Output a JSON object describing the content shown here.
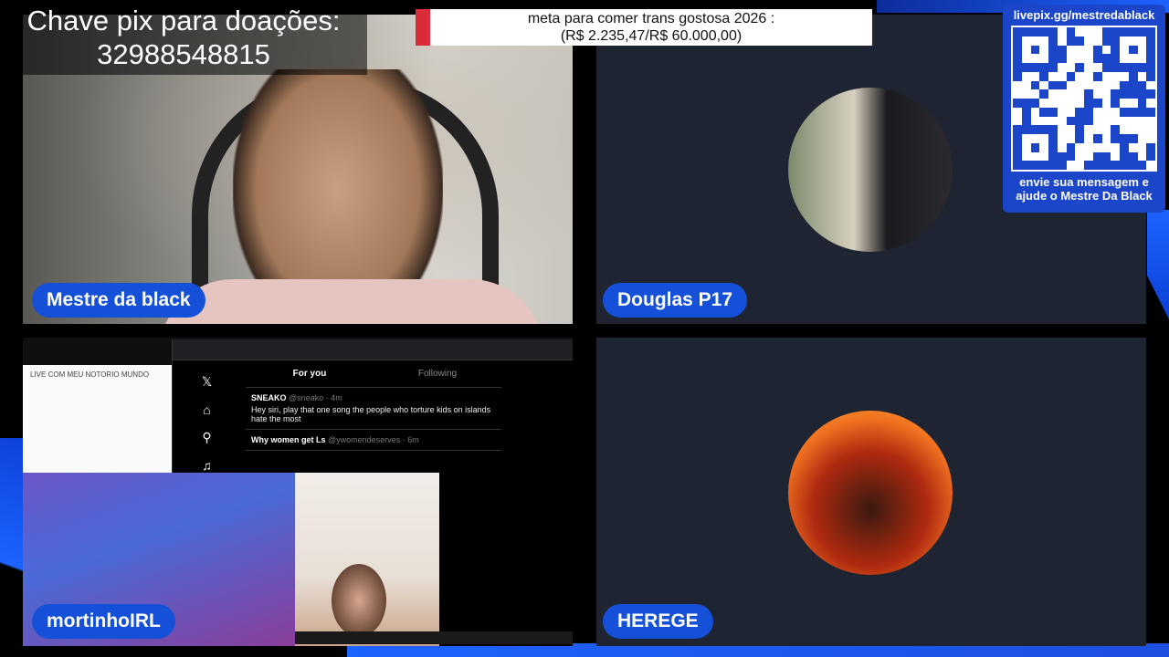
{
  "donation": {
    "line1": "Chave pix para doações:",
    "line2": "32988548815"
  },
  "goal": {
    "line1": "meta para comer trans gostosa 2026 :",
    "line2": "(R$ 2.235,47/R$ 60.000,00)",
    "progress_fraction": 0.037
  },
  "qr": {
    "url": "livepix.gg/mestredablack",
    "message_line1": "envie sua mensagem e",
    "message_line2": "ajude o Mestre Da Black"
  },
  "participants": [
    {
      "name": "Mestre da black"
    },
    {
      "name": "Douglas P17"
    },
    {
      "name": "mortinhoIRL"
    },
    {
      "name": "HEREGE"
    }
  ],
  "screen_share": {
    "meet_title": "LIVE COM MEU NOTORIO MUNDO",
    "tab_for_you": "For you",
    "tab_following": "Following",
    "tweet1_author": "SNEAKO",
    "tweet1_handle": "@sneako · 4m",
    "tweet1_text": "Hey siri, play that one song the people who torture kids on islands hate the most",
    "tweet2_author": "Why women get Ls",
    "tweet2_handle": "@ywomendeserves · 6m"
  },
  "colors": {
    "pill": "#1450d8",
    "tile": "#1f2433",
    "qr_box": "#1b46c9",
    "goal_accent": "#d92b3a"
  }
}
